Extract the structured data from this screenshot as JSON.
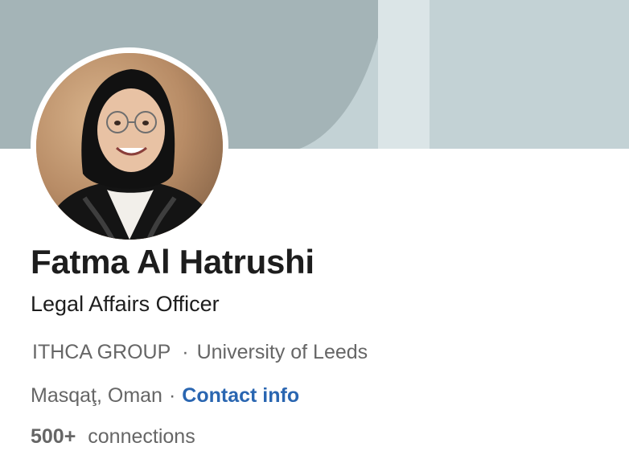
{
  "profile": {
    "name": "Fatma Al Hatrushi",
    "headline": "Legal Affairs Officer",
    "company": "ITHCA GROUP",
    "separator": "·",
    "education": "University of Leeds",
    "location": "Masqaţ, Oman",
    "contact_label": "Contact info",
    "connections_count": "500+",
    "connections_label": "connections"
  },
  "colors": {
    "banner_light": "#c3d2d5",
    "banner_dark": "#a4b4b7",
    "link": "#2a66b1",
    "text_primary": "#1d1d1d",
    "text_secondary": "#666666"
  }
}
